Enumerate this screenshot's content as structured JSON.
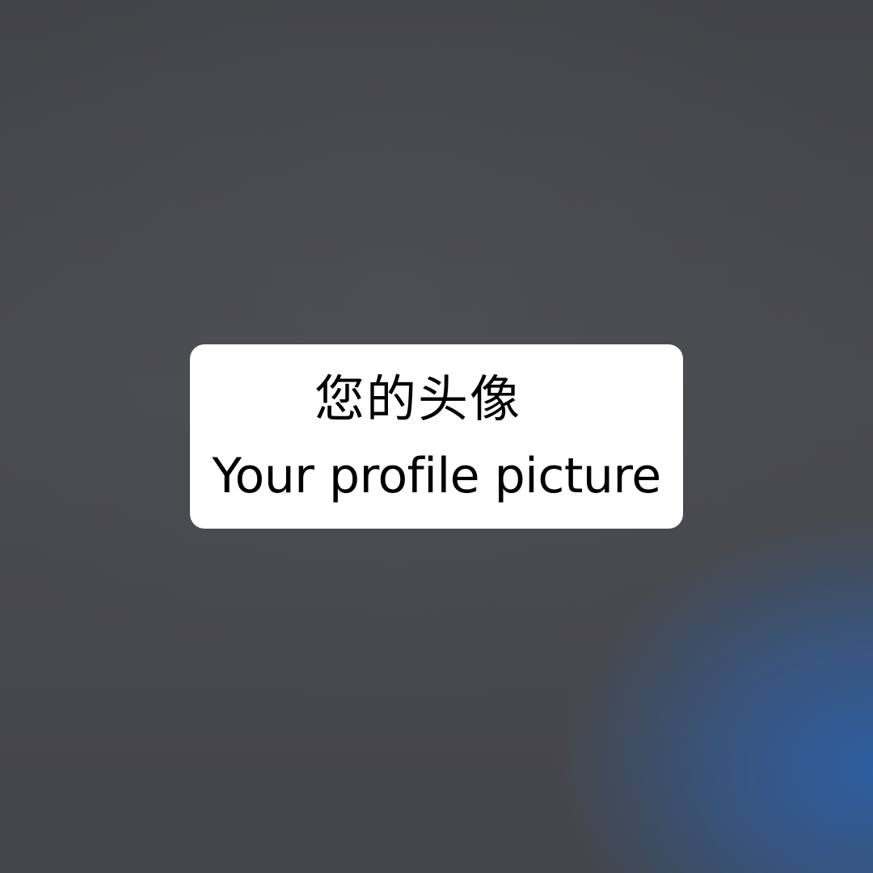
{
  "label": {
    "chinese": "您的头像",
    "english": "Your profile picture"
  },
  "colors": {
    "background": "#45474b",
    "accent_glow": "#2c60a8",
    "card": "#ffffff",
    "text": "#000000"
  }
}
